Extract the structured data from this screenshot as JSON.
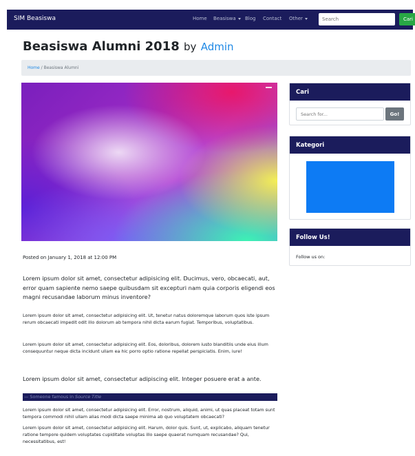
{
  "navbar": {
    "brand": "SIM Beasiswa",
    "links": [
      {
        "label": "Home"
      },
      {
        "label": "Beasiswa"
      },
      {
        "label": "Blog"
      },
      {
        "label": "Contact"
      },
      {
        "label": "Other"
      }
    ],
    "search_placeholder": "Search",
    "search_button": "Cari"
  },
  "page": {
    "title": "Beasiswa Alumni 2018",
    "by": "by",
    "author": "Admin"
  },
  "breadcrumb": {
    "home": "Home",
    "separator": "/",
    "current": "Beasiswa Alumni"
  },
  "post": {
    "posted_on": "Posted on January 1, 2018 at 12:00 PM",
    "lead": "Lorem ipsum dolor sit amet, consectetur adipisicing elit. Ducimus, vero, obcaecati, aut, error quam sapiente nemo saepe quibusdam sit excepturi nam quia corporis eligendi eos magni recusandae laborum minus inventore?",
    "p1": "Lorem ipsum dolor sit amet, consectetur adipisicing elit. Ut, tenetur natus doloremque laborum quos iste ipsum rerum obcaecati impedit odit illo dolorum ab tempora nihil dicta earum fugiat. Temporibus, voluptatibus.",
    "p2": "Lorem ipsum dolor sit amet, consectetur adipisicing elit. Eos, doloribus, dolorem iusto blanditiis unde eius illum consequuntur neque dicta incidunt ullam ea hic porro optio ratione repellat perspiciatis. Enim, iure!",
    "quote": "Lorem ipsum dolor sit amet, consectetur adipiscing elit. Integer posuere erat a ante.",
    "quote_footer_prefix": "— Someone famous in ",
    "quote_source": "Source Title",
    "p3": "Lorem ipsum dolor sit amet, consectetur adipisicing elit. Error, nostrum, aliquid, animi, ut quas placeat totam sunt tempora commodi nihil ullam alias modi dicta saepe minima ab quo voluptatem obcaecati?",
    "p4": "Lorem ipsum dolor sit amet, consectetur adipisicing elit. Harum, dolor quis. Sunt, ut, explicabo, aliquam tenetur ratione tempore quidem voluptates cupiditate voluptas illo saepe quaerat numquam recusandae? Qui, necessitatibus, est!"
  },
  "sidebar": {
    "search": {
      "header": "Cari",
      "placeholder": "Search for...",
      "button": "Go!"
    },
    "kategori": {
      "header": "Kategori"
    },
    "follow": {
      "header": "Follow Us!",
      "text": "Follow us on:"
    }
  },
  "colors": {
    "navbar": "#1b1c5c",
    "accent_link": "#1e88e5",
    "search_button": "#28a745",
    "kategori_box": "#0d7bf4"
  }
}
